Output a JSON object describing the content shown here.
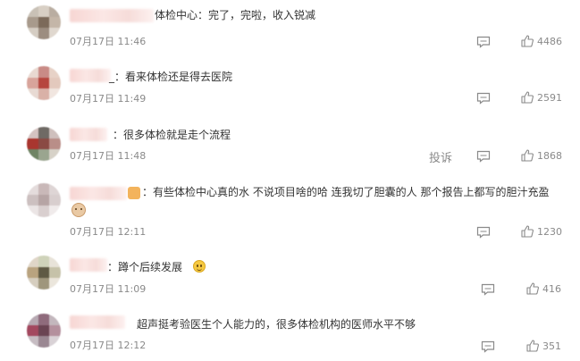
{
  "comments": [
    {
      "text": "体检中心：完了，完啦，收入锐减",
      "time": "07月17日 11:46",
      "likes": "4486"
    },
    {
      "text": "_：看来体检还是得去医院",
      "time": "07月17日 11:49",
      "likes": "2591"
    },
    {
      "text": "：很多体检就是走个流程",
      "time": "07月17日 11:48",
      "likes": "1868",
      "report": "投诉"
    },
    {
      "text": "：有些体检中心真的水 不说项目啥的哈 连我切了胆囊的人 那个报告上都写的胆汁充盈",
      "time": "07月17日 12:11",
      "likes": "1230"
    },
    {
      "text": "：蹲个后续发展",
      "time": "07月17日 11:09",
      "likes": "416"
    },
    {
      "text": "超声挺考验医生个人能力的，很多体检机构的医师水平不够",
      "time": "07月17日 12:12",
      "likes": "351"
    }
  ],
  "icons": {
    "comment": "comment-icon",
    "like": "thumbs-up-icon"
  },
  "colors": {
    "meta": "#8a8a8a",
    "text": "#333333",
    "nick_blur": "#f7d6d3"
  }
}
